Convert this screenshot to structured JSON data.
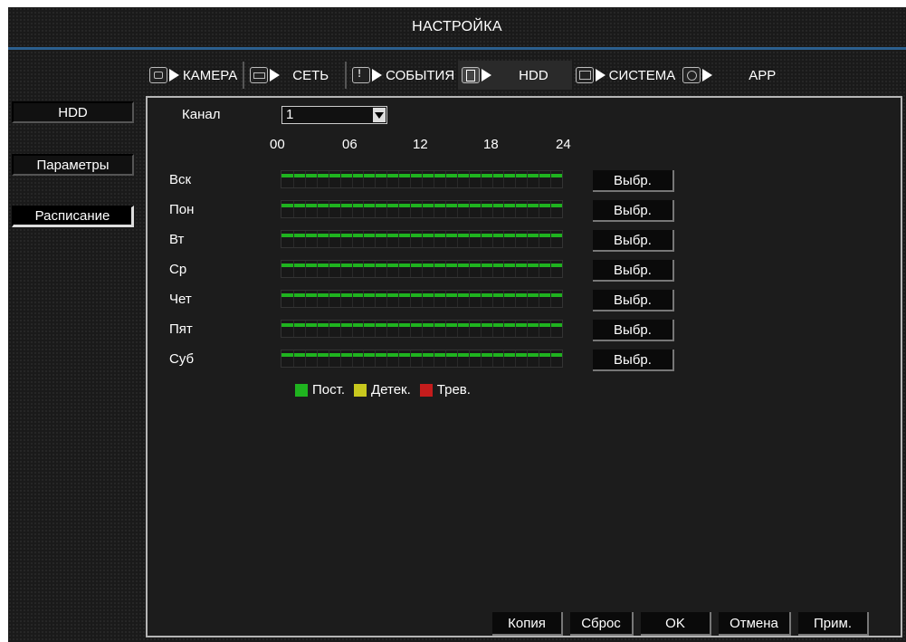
{
  "title": "НАСТРОЙКА",
  "tabs": [
    {
      "label": "КАМЕРА",
      "icon": "camera-icon"
    },
    {
      "label": "СЕТЬ",
      "icon": "network-icon"
    },
    {
      "label": "СОБЫТИЯ",
      "icon": "alarm-icon"
    },
    {
      "label": "HDD",
      "icon": "hdd-icon"
    },
    {
      "label": "СИСТЕМА",
      "icon": "monitor-icon"
    },
    {
      "label": "APP",
      "icon": "app-icon"
    }
  ],
  "active_tab": "HDD",
  "sidebar": {
    "items": [
      {
        "label": "HDD"
      },
      {
        "label": "Параметры"
      },
      {
        "label": "Расписание"
      }
    ],
    "active": "Расписание"
  },
  "channel": {
    "label": "Канал",
    "value": "1"
  },
  "hours": [
    "00",
    "06",
    "12",
    "18",
    "24"
  ],
  "days": [
    {
      "label": "Вск",
      "button": "Выбр."
    },
    {
      "label": "Пон",
      "button": "Выбр."
    },
    {
      "label": "Вт",
      "button": "Выбр."
    },
    {
      "label": "Ср",
      "button": "Выбр."
    },
    {
      "label": "Чет",
      "button": "Выбр."
    },
    {
      "label": "Пят",
      "button": "Выбр."
    },
    {
      "label": "Суб",
      "button": "Выбр."
    }
  ],
  "legend": [
    {
      "label": "Пост.",
      "color": "#1fb31f"
    },
    {
      "label": "Детек.",
      "color": "#c8c81e"
    },
    {
      "label": "Трев.",
      "color": "#c41c1c"
    }
  ],
  "buttons": {
    "copy": "Копия",
    "reset": "Сброс",
    "ok": "OK",
    "cancel": "Отмена",
    "apply": "Прим."
  }
}
